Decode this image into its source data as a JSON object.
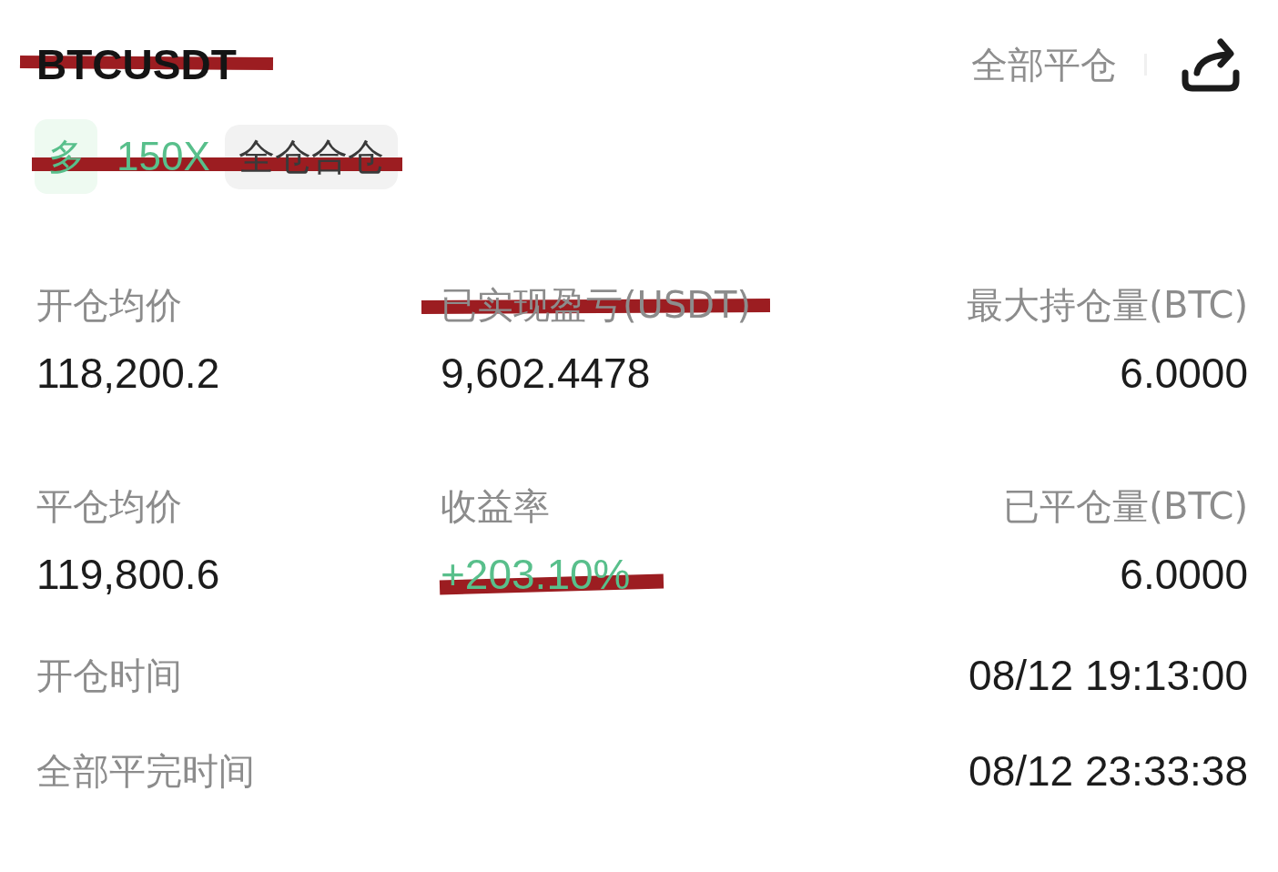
{
  "header": {
    "symbol": "BTCUSDT",
    "symbol_struck": true,
    "close_all_button": "全部平仓"
  },
  "position_tags": {
    "struck": true,
    "items": [
      {
        "kind": "side",
        "text": "多"
      },
      {
        "kind": "leverage",
        "text": "150X"
      },
      {
        "kind": "margin_mode",
        "text": "全仓合仓"
      }
    ]
  },
  "stats": [
    {
      "label": "开仓均价",
      "value": "118,200.2",
      "kind": "plain",
      "label_struck": false,
      "value_struck": false
    },
    {
      "label": "已实现盈亏(USDT)",
      "value": "9,602.4478",
      "kind": "plain",
      "label_struck": true,
      "value_struck": false
    },
    {
      "label": "最大持仓量(BTC)",
      "value": "6.0000",
      "kind": "plain",
      "label_struck": false,
      "value_struck": false
    },
    {
      "label": "平仓均价",
      "value": "119,800.6",
      "kind": "plain",
      "label_struck": false,
      "value_struck": false
    },
    {
      "label": "收益率",
      "value": "+203.10%",
      "kind": "gain",
      "label_struck": false,
      "value_struck": true
    },
    {
      "label": "已平仓量(BTC)",
      "value": "6.0000",
      "kind": "plain",
      "label_struck": false,
      "value_struck": false
    }
  ],
  "times": [
    {
      "label": "开仓时间",
      "value": "08/12 19:13:00"
    },
    {
      "label": "全部平完时间",
      "value": "08/12 23:33:38"
    }
  ]
}
